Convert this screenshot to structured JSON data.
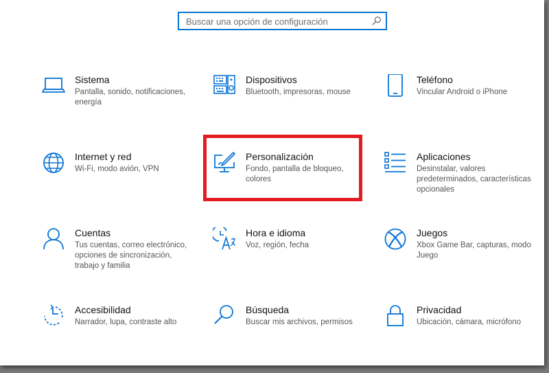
{
  "search": {
    "placeholder": "Buscar una opción de configuración"
  },
  "tiles": [
    {
      "title": "Sistema",
      "desc": "Pantalla, sonido, notificaciones, energía",
      "icon": "laptop-icon"
    },
    {
      "title": "Dispositivos",
      "desc": "Bluetooth, impresoras, mouse",
      "icon": "keyboard-speaker-icon"
    },
    {
      "title": "Teléfono",
      "desc": "Vincular Android o iPhone",
      "icon": "phone-icon"
    },
    {
      "title": "Internet y red",
      "desc": "Wi-Fi, modo avión, VPN",
      "icon": "globe-icon"
    },
    {
      "title": "Personalización",
      "desc": "Fondo, pantalla de bloqueo, colores",
      "icon": "paint-monitor-icon"
    },
    {
      "title": "Aplicaciones",
      "desc": "Desinstalar, valores predeterminados, características opcionales",
      "icon": "apps-list-icon"
    },
    {
      "title": "Cuentas",
      "desc": "Tus cuentas, correo electrónico, opciones de sincronización, trabajo y familia",
      "icon": "person-icon"
    },
    {
      "title": "Hora e idioma",
      "desc": "Voz, región, fecha",
      "icon": "time-language-icon"
    },
    {
      "title": "Juegos",
      "desc": "Xbox Game Bar, capturas, modo Juego",
      "icon": "xbox-icon"
    },
    {
      "title": "Accesibilidad",
      "desc": "Narrador, lupa, contraste alto",
      "icon": "accessibility-icon"
    },
    {
      "title": "Búsqueda",
      "desc": "Buscar mis archivos, permisos",
      "icon": "search-icon"
    },
    {
      "title": "Privacidad",
      "desc": "Ubicación, cámara, micrófono",
      "icon": "lock-icon"
    }
  ],
  "colors": {
    "accent": "#0a74d6",
    "highlight": "#e31b23"
  }
}
